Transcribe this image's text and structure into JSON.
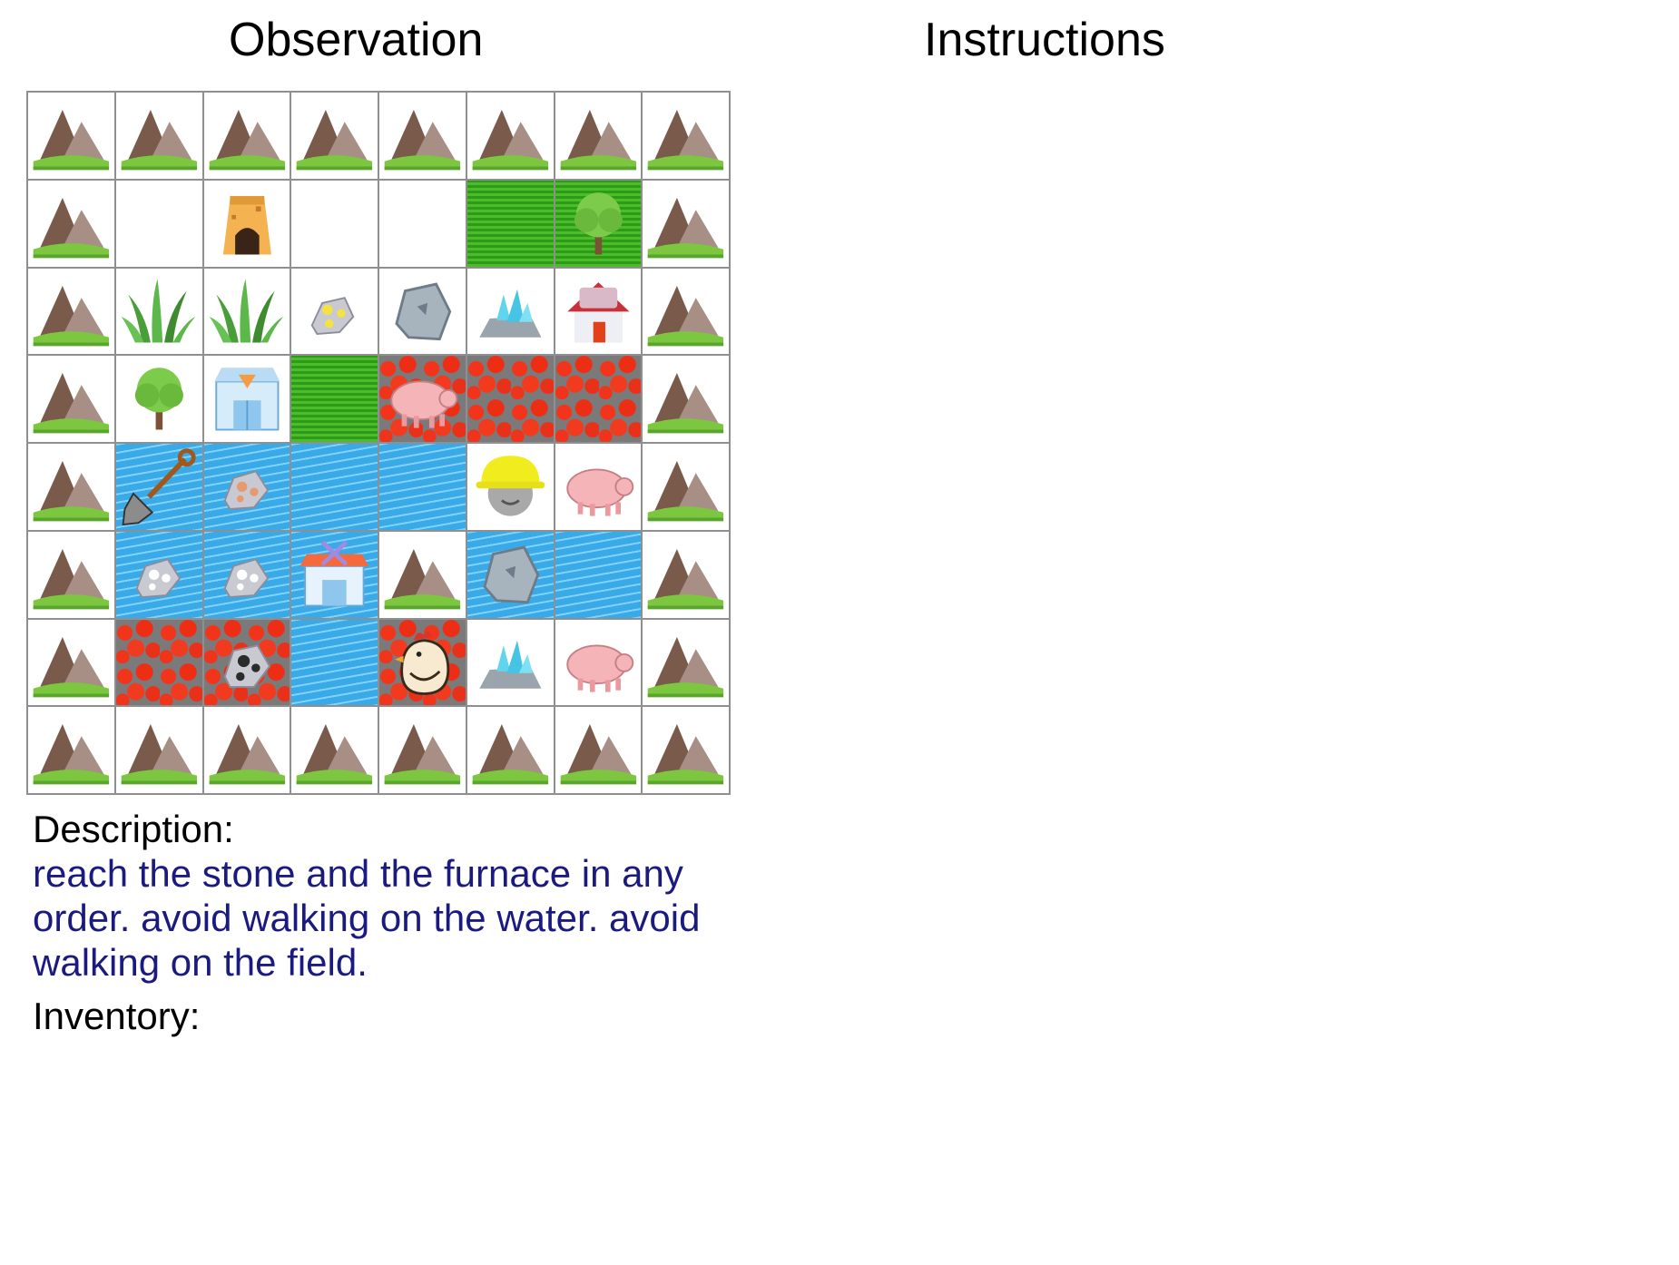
{
  "headers": {
    "observation": "Observation",
    "instructions": "Instructions"
  },
  "description_label": "Description:",
  "description_text": "reach the stone and the furnace in any order. avoid walking on the water. avoid walking on the field.",
  "inventory_label": "Inventory:",
  "grid": [
    [
      [
        "plain",
        "mountain"
      ],
      [
        "plain",
        "mountain"
      ],
      [
        "plain",
        "mountain"
      ],
      [
        "plain",
        "mountain"
      ],
      [
        "plain",
        "mountain"
      ],
      [
        "plain",
        "mountain"
      ],
      [
        "plain",
        "mountain"
      ],
      [
        "plain",
        "mountain"
      ]
    ],
    [
      [
        "plain",
        "mountain"
      ],
      [
        "plain",
        ""
      ],
      [
        "plain",
        "furnace"
      ],
      [
        "plain",
        ""
      ],
      [
        "plain",
        ""
      ],
      [
        "grass",
        ""
      ],
      [
        "grass",
        "tree"
      ],
      [
        "plain",
        "mountain"
      ]
    ],
    [
      [
        "plain",
        "mountain"
      ],
      [
        "plain",
        "tall-grass"
      ],
      [
        "plain",
        "tall-grass"
      ],
      [
        "plain",
        "gold-ore"
      ],
      [
        "plain",
        "stone"
      ],
      [
        "plain",
        "diamond"
      ],
      [
        "plain",
        "house"
      ],
      [
        "plain",
        "mountain"
      ]
    ],
    [
      [
        "plain",
        "mountain"
      ],
      [
        "plain",
        "tree"
      ],
      [
        "plain",
        "shop"
      ],
      [
        "grass",
        ""
      ],
      [
        "lava",
        "pig"
      ],
      [
        "lava",
        ""
      ],
      [
        "lava",
        ""
      ],
      [
        "plain",
        "mountain"
      ]
    ],
    [
      [
        "plain",
        "mountain"
      ],
      [
        "water",
        "shovel"
      ],
      [
        "water",
        "iron-ore"
      ],
      [
        "water",
        ""
      ],
      [
        "water",
        ""
      ],
      [
        "plain",
        "player"
      ],
      [
        "plain",
        "pig"
      ],
      [
        "plain",
        "mountain"
      ]
    ],
    [
      [
        "plain",
        "mountain"
      ],
      [
        "water",
        "silver-ore"
      ],
      [
        "water",
        "silver-ore"
      ],
      [
        "water",
        "workshop"
      ],
      [
        "plain",
        "mountain"
      ],
      [
        "water",
        "stone"
      ],
      [
        "water",
        ""
      ],
      [
        "plain",
        "mountain"
      ]
    ],
    [
      [
        "plain",
        "mountain"
      ],
      [
        "lava",
        ""
      ],
      [
        "lava",
        "coal-ore"
      ],
      [
        "water",
        ""
      ],
      [
        "lava",
        "chicken"
      ],
      [
        "plain",
        "diamond"
      ],
      [
        "plain",
        "pig"
      ],
      [
        "plain",
        "mountain"
      ]
    ],
    [
      [
        "plain",
        "mountain"
      ],
      [
        "plain",
        "mountain"
      ],
      [
        "plain",
        "mountain"
      ],
      [
        "plain",
        "mountain"
      ],
      [
        "plain",
        "mountain"
      ],
      [
        "plain",
        "mountain"
      ],
      [
        "plain",
        "mountain"
      ],
      [
        "plain",
        "mountain"
      ]
    ]
  ],
  "colors": {
    "description_text": "#1a1a80",
    "grid_line": "#8f8f8f"
  }
}
